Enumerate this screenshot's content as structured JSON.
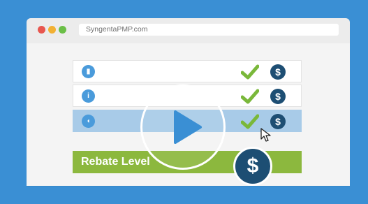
{
  "colors": {
    "frame": "#3a8fd4",
    "check": "#7ab83a",
    "dollar": "#1d4e73",
    "rebate": "#8cb83e",
    "highlight_row": "#a8cbe8",
    "dot_red": "#e8574f",
    "dot_yellow": "#f2b134",
    "dot_green": "#6bbf47"
  },
  "browser": {
    "url": "SyngentaPMP.com"
  },
  "rows": [
    {
      "leaf_glyph": "▮",
      "check_icon": "check-icon",
      "dollar_glyph": "$"
    },
    {
      "leaf_glyph": "i",
      "check_icon": "check-icon",
      "dollar_glyph": "$"
    },
    {
      "leaf_glyph": "◖",
      "check_icon": "check-icon",
      "dollar_glyph": "$"
    }
  ],
  "rebate": {
    "label": "Rebate Level",
    "dollar_glyph": "$"
  },
  "video": {
    "play_icon": "play-icon"
  }
}
